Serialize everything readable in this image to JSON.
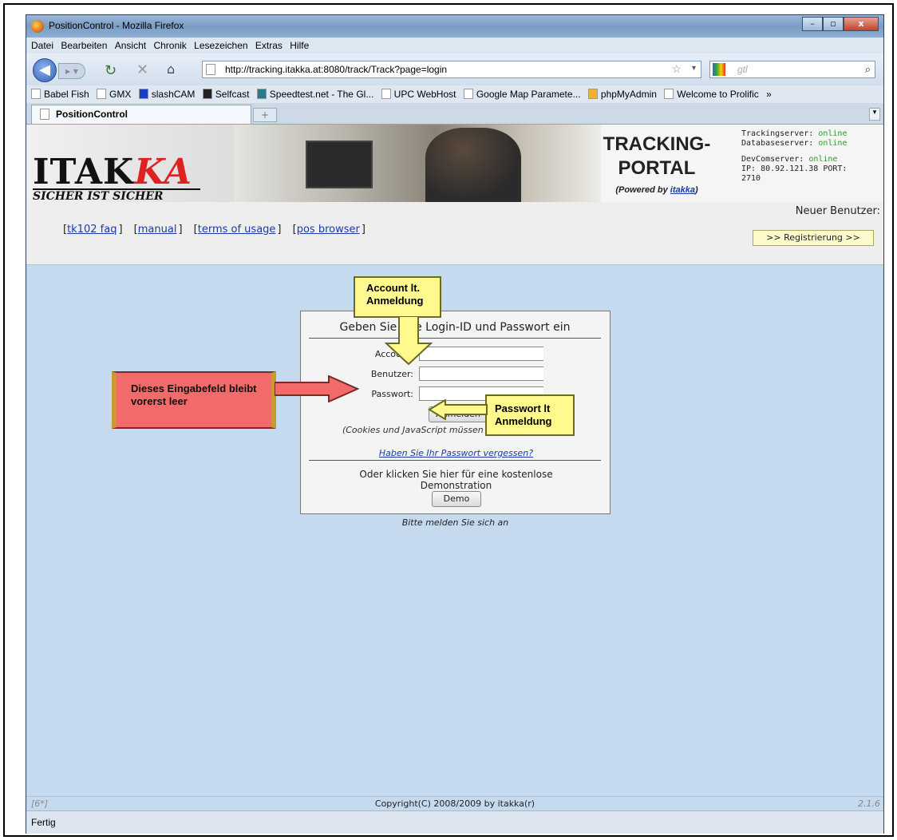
{
  "window": {
    "title": "PositionControl - Mozilla Firefox",
    "controls": [
      "–",
      "▫",
      "x"
    ]
  },
  "menu": [
    "Datei",
    "Bearbeiten",
    "Ansicht",
    "Chronik",
    "Lesezeichen",
    "Extras",
    "Hilfe"
  ],
  "nav": {
    "url": "http://tracking.itakka.at:8080/track/Track?page=login",
    "search_placeholder": "gtl"
  },
  "bookmarks": [
    "Babel Fish",
    "GMX",
    "slashCAM",
    "Selfcast",
    "Speedtest.net - The Gl...",
    "UPC WebHost",
    "Google Map Paramete...",
    "phpMyAdmin",
    "Welcome to Prolific",
    "»"
  ],
  "tab": {
    "label": "PositionControl",
    "new_tab": "+"
  },
  "banner": {
    "logo_main": "ITAK",
    "logo_red": "KA",
    "slogan": "SICHER IST SICHER",
    "portal_title_1": "TRACKING-",
    "portal_title_2": "PORTAL",
    "powered_prefix": "(Powered by ",
    "powered_link": "itakka",
    "powered_suffix": ")",
    "status_tracking_label": "Trackingserver:",
    "status_tracking_value": "online",
    "status_database_label": "Databaseserver:",
    "status_database_value": "online",
    "status_devcom_label": "DevComserver:",
    "status_devcom_value": "online",
    "status_ip": "IP: 80.92.121.38 PORT:",
    "status_port": "2710"
  },
  "links": {
    "items": [
      "tk102 faq",
      "manual",
      "terms of usage",
      "pos browser"
    ],
    "neuer_benutzer": "Neuer Benutzer:",
    "register": ">> Registrierung >>"
  },
  "login": {
    "title": "Geben Sie Ihre Login-ID und Passwort ein",
    "account_label": "Account:",
    "benutzer_label": "Benutzer:",
    "passwort_label": "Passwort:",
    "submit": "Anmelden",
    "cookies_note": "(Cookies und JavaScript müssen eingeschaltet sein)",
    "forgot": "Haben Sie Ihr Passwort vergessen?",
    "demo_text": "Oder klicken Sie hier für eine kostenlose Demonstration",
    "demo_button": "Demo",
    "below": "Bitte melden Sie sich an"
  },
  "footer": {
    "left": "[6*]",
    "copyright": "Copyright(C) 2008/2009 by itakka(r)",
    "version": "2.1.6"
  },
  "statusbar": "Fertig",
  "callouts": {
    "account": "Account lt. Anmeldung",
    "password": "Passwort lt Anmeldung",
    "empty_field": "Dieses Eingabefeld bleibt vorerst leer"
  },
  "colors": {
    "page_bg": "#c5d9ef",
    "callout_yellow": "#fff98e",
    "callout_red": "#f26a6a",
    "online": "#2a9a2a"
  }
}
